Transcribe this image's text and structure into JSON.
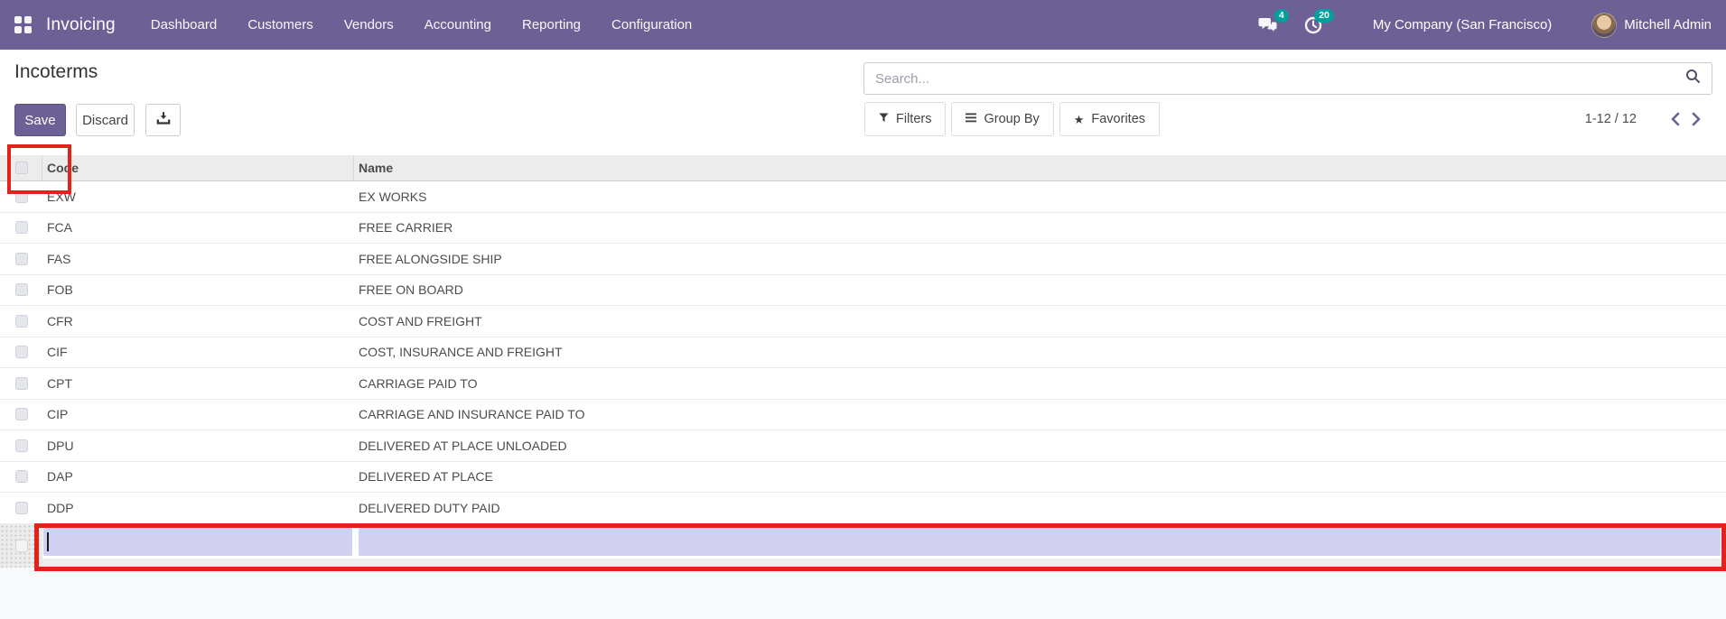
{
  "nav": {
    "app_name": "Invoicing",
    "menus": [
      "Dashboard",
      "Customers",
      "Vendors",
      "Accounting",
      "Reporting",
      "Configuration"
    ],
    "messages_badge": "4",
    "activities_badge": "20",
    "company": "My Company (San Francisco)",
    "user": "Mitchell Admin"
  },
  "control_panel": {
    "title": "Incoterms",
    "save_label": "Save",
    "discard_label": "Discard",
    "search_placeholder": "Search...",
    "filters_label": "Filters",
    "group_by_label": "Group By",
    "favorites_label": "Favorites",
    "favorites_glyph": "★",
    "pager": "1-12 / 12"
  },
  "table": {
    "columns": [
      "Code",
      "Name"
    ],
    "rows": [
      {
        "code": "EXW",
        "name": "EX WORKS"
      },
      {
        "code": "FCA",
        "name": "FREE CARRIER"
      },
      {
        "code": "FAS",
        "name": "FREE ALONGSIDE SHIP"
      },
      {
        "code": "FOB",
        "name": "FREE ON BOARD"
      },
      {
        "code": "CFR",
        "name": "COST AND FREIGHT"
      },
      {
        "code": "CIF",
        "name": "COST, INSURANCE AND FREIGHT"
      },
      {
        "code": "CPT",
        "name": "CARRIAGE PAID TO"
      },
      {
        "code": "CIP",
        "name": "CARRIAGE AND INSURANCE PAID TO"
      },
      {
        "code": "DPU",
        "name": "DELIVERED AT PLACE UNLOADED"
      },
      {
        "code": "DAP",
        "name": "DELIVERED AT PLACE"
      },
      {
        "code": "DDP",
        "name": "DELIVERED DUTY PAID"
      }
    ],
    "new_row": {
      "code_value": "",
      "name_value": ""
    }
  },
  "icons": {
    "apps": "grid-2x2",
    "messages": "speech-bubbles",
    "activities": "clock",
    "export": "download-into-tray",
    "search": "magnifier",
    "filter": "funnel",
    "group_by": "bars",
    "favorites": "star",
    "prev": "chevron-left",
    "next": "chevron-right"
  },
  "colors": {
    "navbar": "#6d6094",
    "badge": "#00a09d",
    "annotation": "#e2231c",
    "edit_field": "#d2d1f2",
    "header_row_bg": "#ececec",
    "page_bottom_bg": "#f8f9fa"
  }
}
